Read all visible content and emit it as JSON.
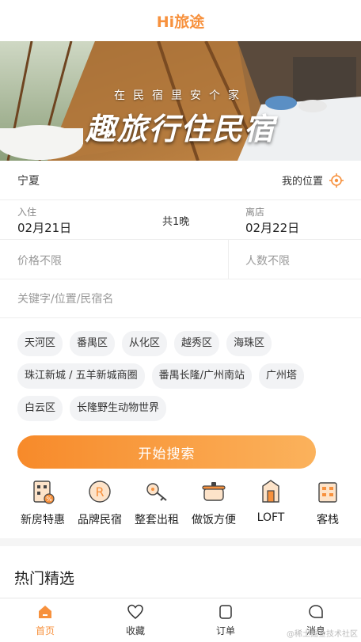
{
  "header": {
    "title": "Hi旅途"
  },
  "banner": {
    "subtitle": "在民宿里安个家",
    "headline": "趣旅行住民宿"
  },
  "location": {
    "city": "宁夏",
    "my_location_label": "我的位置"
  },
  "dates": {
    "checkin_label": "入住",
    "checkin_value": "02月21日",
    "nights": "共1晚",
    "checkout_label": "离店",
    "checkout_value": "02月22日"
  },
  "filters": {
    "price": "价格不限",
    "people": "人数不限"
  },
  "keyword": {
    "placeholder": "关键字/位置/民宿名"
  },
  "tags": [
    "天河区",
    "番禺区",
    "从化区",
    "越秀区",
    "海珠区",
    "珠江新城 / 五羊新城商圈",
    "番禺长隆/广州南站",
    "广州塔",
    "白云区",
    "长隆野生动物世界"
  ],
  "search_button": "开始搜索",
  "categories": [
    {
      "label": "新房特惠",
      "icon": "new-house-icon"
    },
    {
      "label": "品牌民宿",
      "icon": "brand-icon"
    },
    {
      "label": "整套出租",
      "icon": "key-icon"
    },
    {
      "label": "做饭方便",
      "icon": "cooking-pot-icon"
    },
    {
      "label": "LOFT",
      "icon": "loft-icon"
    },
    {
      "label": "客栈",
      "icon": "inn-icon"
    }
  ],
  "section": {
    "hot_title": "热门精选"
  },
  "tabbar": {
    "items": [
      {
        "label": "首页",
        "icon": "home-icon",
        "active": true
      },
      {
        "label": "收藏",
        "icon": "heart-icon",
        "active": false
      },
      {
        "label": "订单",
        "icon": "order-icon",
        "active": false
      },
      {
        "label": "消息",
        "icon": "message-icon",
        "active": false
      }
    ]
  },
  "watermark": "@稀土掘金技术社区",
  "colors": {
    "accent": "#f7913d",
    "accent_gradient_end": "#fbb25c"
  }
}
